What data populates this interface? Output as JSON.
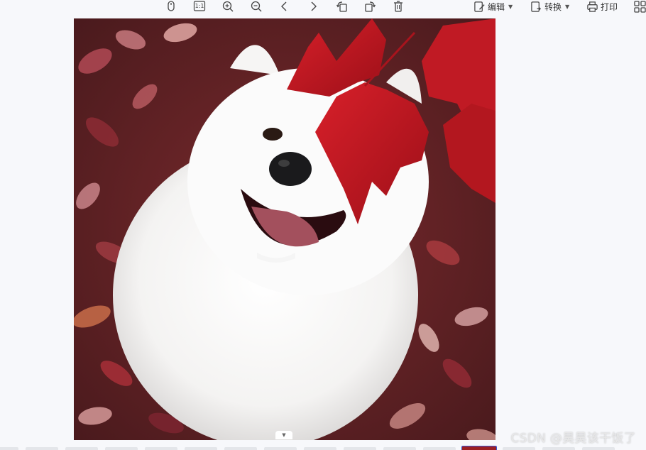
{
  "toolbar": {
    "buttons": [
      {
        "icon": "mouse-icon"
      },
      {
        "icon": "actual-size-icon",
        "label": "1:1"
      },
      {
        "icon": "zoom-in-icon"
      },
      {
        "icon": "zoom-out-icon"
      },
      {
        "icon": "previous-icon"
      },
      {
        "icon": "next-icon"
      },
      {
        "icon": "rotate-left-icon"
      },
      {
        "icon": "rotate-right-icon"
      },
      {
        "icon": "delete-icon"
      }
    ],
    "edit_label": "编辑",
    "convert_label": "转换",
    "print_label": "打印"
  },
  "watermark": "CSDN @昊昊该干饭了",
  "thumbnails": {
    "count": 16,
    "active_index": 12
  },
  "colors": {
    "accent": "#3a56d8",
    "toolbar_icon": "#444444"
  }
}
